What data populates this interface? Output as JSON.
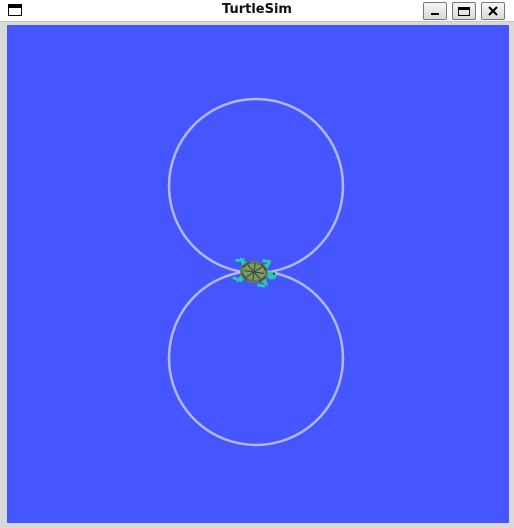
{
  "window": {
    "title": "TurtleSim"
  },
  "colors": {
    "background": "#4556ff",
    "pen": "#b3b8ff",
    "turtle_shell": "#6f8a5d",
    "turtle_limbs": "#27c9b0"
  },
  "icons": {
    "window_menu": "window-menu-icon",
    "minimize": "minimize-icon",
    "maximize": "maximize-icon",
    "close": "close-icon",
    "turtle": "turtle-icon"
  }
}
